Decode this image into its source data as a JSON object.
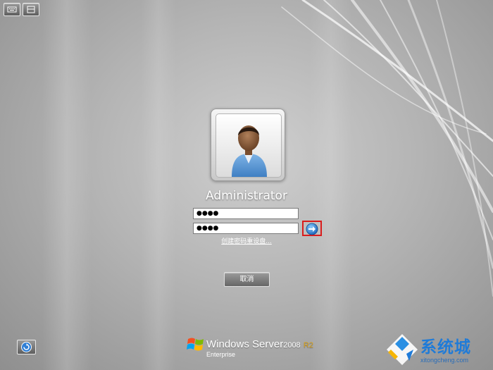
{
  "user": {
    "name": "Administrator"
  },
  "fields": {
    "old_password": "●●●●",
    "new_password": "●●●●"
  },
  "links": {
    "reset_disk": "创建密码重设盘..."
  },
  "buttons": {
    "cancel": "取消"
  },
  "branding": {
    "product": "Windows Server",
    "version": "2008",
    "release": "R2",
    "edition": "Enterprise"
  },
  "watermark": {
    "title": "系统城",
    "url": "xitongcheng.com"
  },
  "icons": {
    "top_left_1": "keyboard-icon",
    "top_left_2": "ime-icon",
    "submit": "arrow-right-icon",
    "ease_of_access": "ease-of-access-icon",
    "windows_logo": "windows-flag-icon"
  },
  "colors": {
    "highlight_border": "#d91c1c",
    "watermark_blue": "#1f7bd8"
  }
}
